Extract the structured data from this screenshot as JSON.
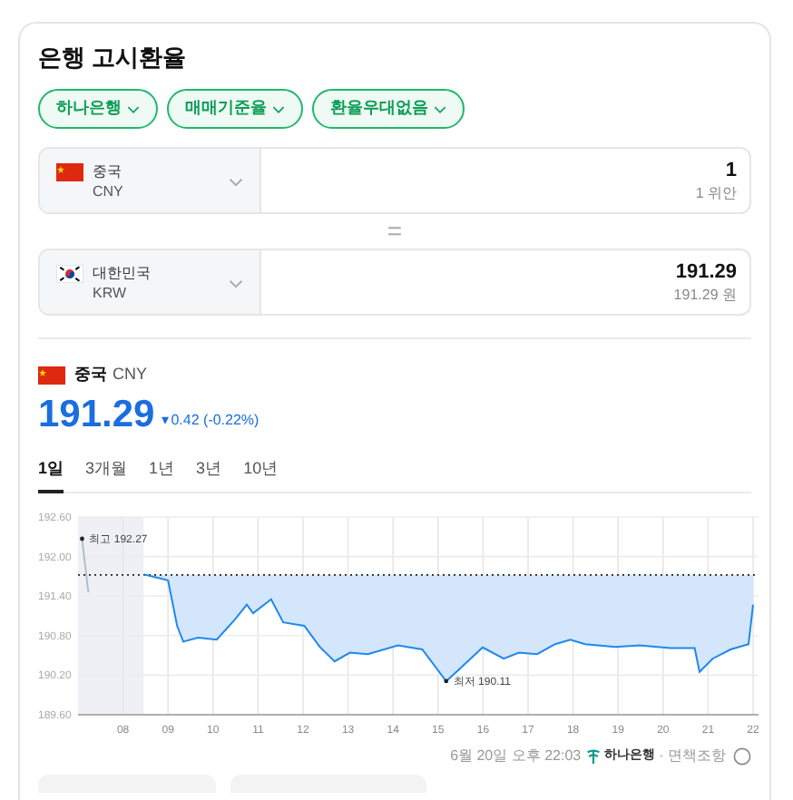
{
  "title": "은행 고시환율",
  "filters": [
    {
      "label": "하나은행"
    },
    {
      "label": "매매기준율"
    },
    {
      "label": "환율우대없음"
    }
  ],
  "converter": [
    {
      "country": "중국",
      "code": "CNY",
      "amount": "1",
      "amount_text": "1 위안"
    },
    {
      "country": "대한민국",
      "code": "KRW",
      "amount": "191.29",
      "amount_text": "191.29 원"
    }
  ],
  "equals": "=",
  "quote": {
    "country": "중국",
    "code": "CNY",
    "rate": "191.29",
    "change_icon": "▾",
    "change": "0.42 (-0.22%)"
  },
  "periods": [
    {
      "label": "1일",
      "selected": true
    },
    {
      "label": "3개월",
      "selected": false
    },
    {
      "label": "1년",
      "selected": false
    },
    {
      "label": "3년",
      "selected": false
    },
    {
      "label": "10년",
      "selected": false
    }
  ],
  "chart": {
    "chart_data": {
      "type": "line",
      "grid": true,
      "x": [
        7.09,
        7.23,
        8.46,
        9.0,
        9.2,
        9.34,
        9.67,
        10.08,
        10.48,
        10.75,
        10.89,
        11.29,
        11.56,
        12.03,
        12.37,
        12.7,
        13.04,
        13.44,
        14.11,
        14.65,
        15.18,
        15.58,
        15.99,
        16.46,
        16.8,
        17.2,
        17.6,
        17.94,
        18.27,
        18.94,
        19.48,
        20.16,
        20.7,
        20.81,
        21.1,
        21.5,
        21.9,
        22.0
      ],
      "series": [
        {
          "color": "#b4bccb",
          "values": [
            192.27,
            191.46,
            null,
            null,
            null,
            null,
            null,
            null,
            null,
            null,
            null,
            null,
            null,
            null,
            null,
            null,
            null,
            null,
            null,
            null,
            null,
            null,
            null,
            null,
            null,
            null,
            null,
            null,
            null,
            null,
            null,
            null,
            null,
            null,
            null,
            null,
            null,
            null
          ]
        },
        {
          "color": "#1e88f0",
          "values": [
            null,
            null,
            191.73,
            191.64,
            190.95,
            190.71,
            190.77,
            190.74,
            191.04,
            191.27,
            191.14,
            191.35,
            191.0,
            190.95,
            190.63,
            190.41,
            190.54,
            190.52,
            190.65,
            190.59,
            190.11,
            190.36,
            190.62,
            190.45,
            190.54,
            190.52,
            190.67,
            190.74,
            190.67,
            190.63,
            190.65,
            190.61,
            190.61,
            190.25,
            190.45,
            190.59,
            190.67,
            191.27
          ]
        }
      ],
      "ref_lines": [
        {
          "axis": "y",
          "value": 191.72
        }
      ],
      "bands": [
        {
          "axis": "x",
          "from": 7.0,
          "to": 8.46
        }
      ],
      "xlim": [
        7.0,
        22.04
      ],
      "ylim": [
        189.6,
        192.6
      ],
      "xticks": [
        {
          "value": 8,
          "label": "08"
        },
        {
          "value": 9,
          "label": "09"
        },
        {
          "value": 10,
          "label": "10"
        },
        {
          "value": 11,
          "label": "11"
        },
        {
          "value": 12,
          "label": "12"
        },
        {
          "value": 13,
          "label": "13"
        },
        {
          "value": 14,
          "label": "14"
        },
        {
          "value": 15,
          "label": "15"
        },
        {
          "value": 16,
          "label": "16"
        },
        {
          "value": 17,
          "label": "17"
        },
        {
          "value": 18,
          "label": "18"
        },
        {
          "value": 19,
          "label": "19"
        },
        {
          "value": 20,
          "label": "20"
        },
        {
          "value": 21,
          "label": "21"
        },
        {
          "value": 22,
          "label": "22"
        }
      ],
      "yticks": [
        {
          "value": 192.6,
          "label": "192.60"
        },
        {
          "value": 192.0,
          "label": "192.00"
        },
        {
          "value": 191.4,
          "label": "191.40"
        },
        {
          "value": 190.8,
          "label": "190.80"
        },
        {
          "value": 190.2,
          "label": "190.20"
        },
        {
          "value": 189.6,
          "label": "189.60"
        }
      ],
      "annotations": [
        {
          "text": "최고 192.27",
          "x": 7.09,
          "y": 192.27
        },
        {
          "text": "최저 190.11",
          "x": 15.18,
          "y": 190.11
        }
      ]
    }
  },
  "footer": {
    "time": "6월 20일 오후 22:03",
    "bank": "하나은행",
    "disclaimer": "· 면책조항"
  }
}
